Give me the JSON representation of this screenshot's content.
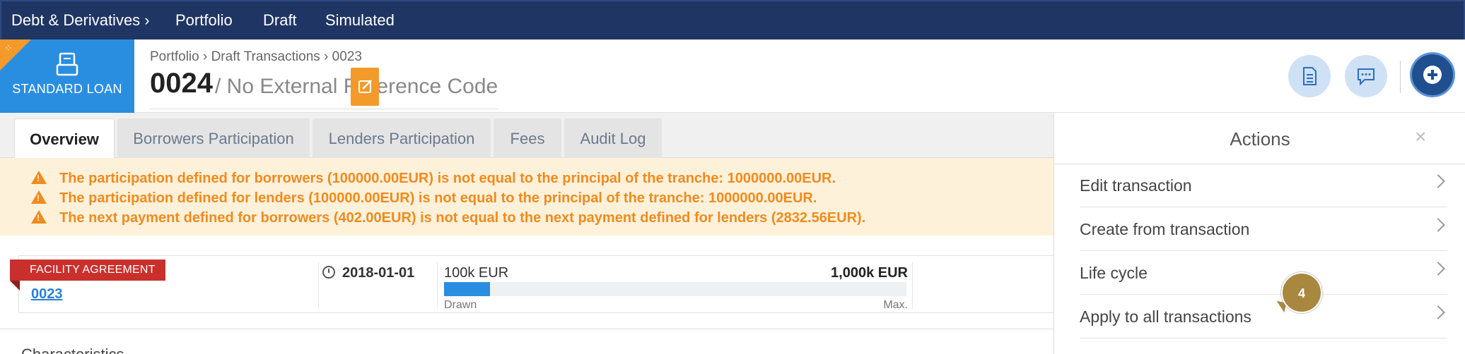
{
  "topnav": {
    "items": [
      "Debt & Derivatives ›",
      "Portfolio",
      "Draft",
      "Simulated"
    ]
  },
  "header": {
    "type_label": "STANDARD LOAN",
    "breadcrumb": "Portfolio › Draft Transactions ›  0023",
    "title_number": "0024",
    "title_ref": "/ No External Reference Code",
    "icons": [
      "document-icon",
      "comment-icon",
      "plus-icon",
      "edit-icon"
    ]
  },
  "tabs": [
    "Overview",
    "Borrowers Participation",
    "Lenders Participation",
    "Fees",
    "Audit Log"
  ],
  "warnings": [
    "The participation defined for borrowers (100000.00EUR) is not equal to the principal of the tranche: 1000000.00EUR.",
    "The participation defined for lenders (100000.00EUR) is not equal to the principal of the tranche: 1000000.00EUR.",
    "The next payment defined for borrowers (402.00EUR) is not equal to the next payment defined for lenders (2832.56EUR)."
  ],
  "facility": {
    "ribbon": "FACILITY AGREEMENT",
    "link": "0023",
    "date": "2018-01-01",
    "drawn_amount": "100k EUR",
    "max_amount": "1,000k EUR",
    "drawn_label": "Drawn",
    "max_label": "Max.",
    "progress_fraction": 0.1
  },
  "section_peek": "Characteristics",
  "actions": {
    "title": "Actions",
    "close": "×",
    "items": [
      "Edit transaction",
      "Create from transaction",
      "Life cycle",
      "Apply to all transactions"
    ]
  },
  "step_badge": "4",
  "colors": {
    "nav_bg": "#1f3564",
    "accent": "#2a8ee0",
    "warning": "#f08b1e",
    "ribbon": "#c9302c",
    "edit": "#f39a2a"
  }
}
